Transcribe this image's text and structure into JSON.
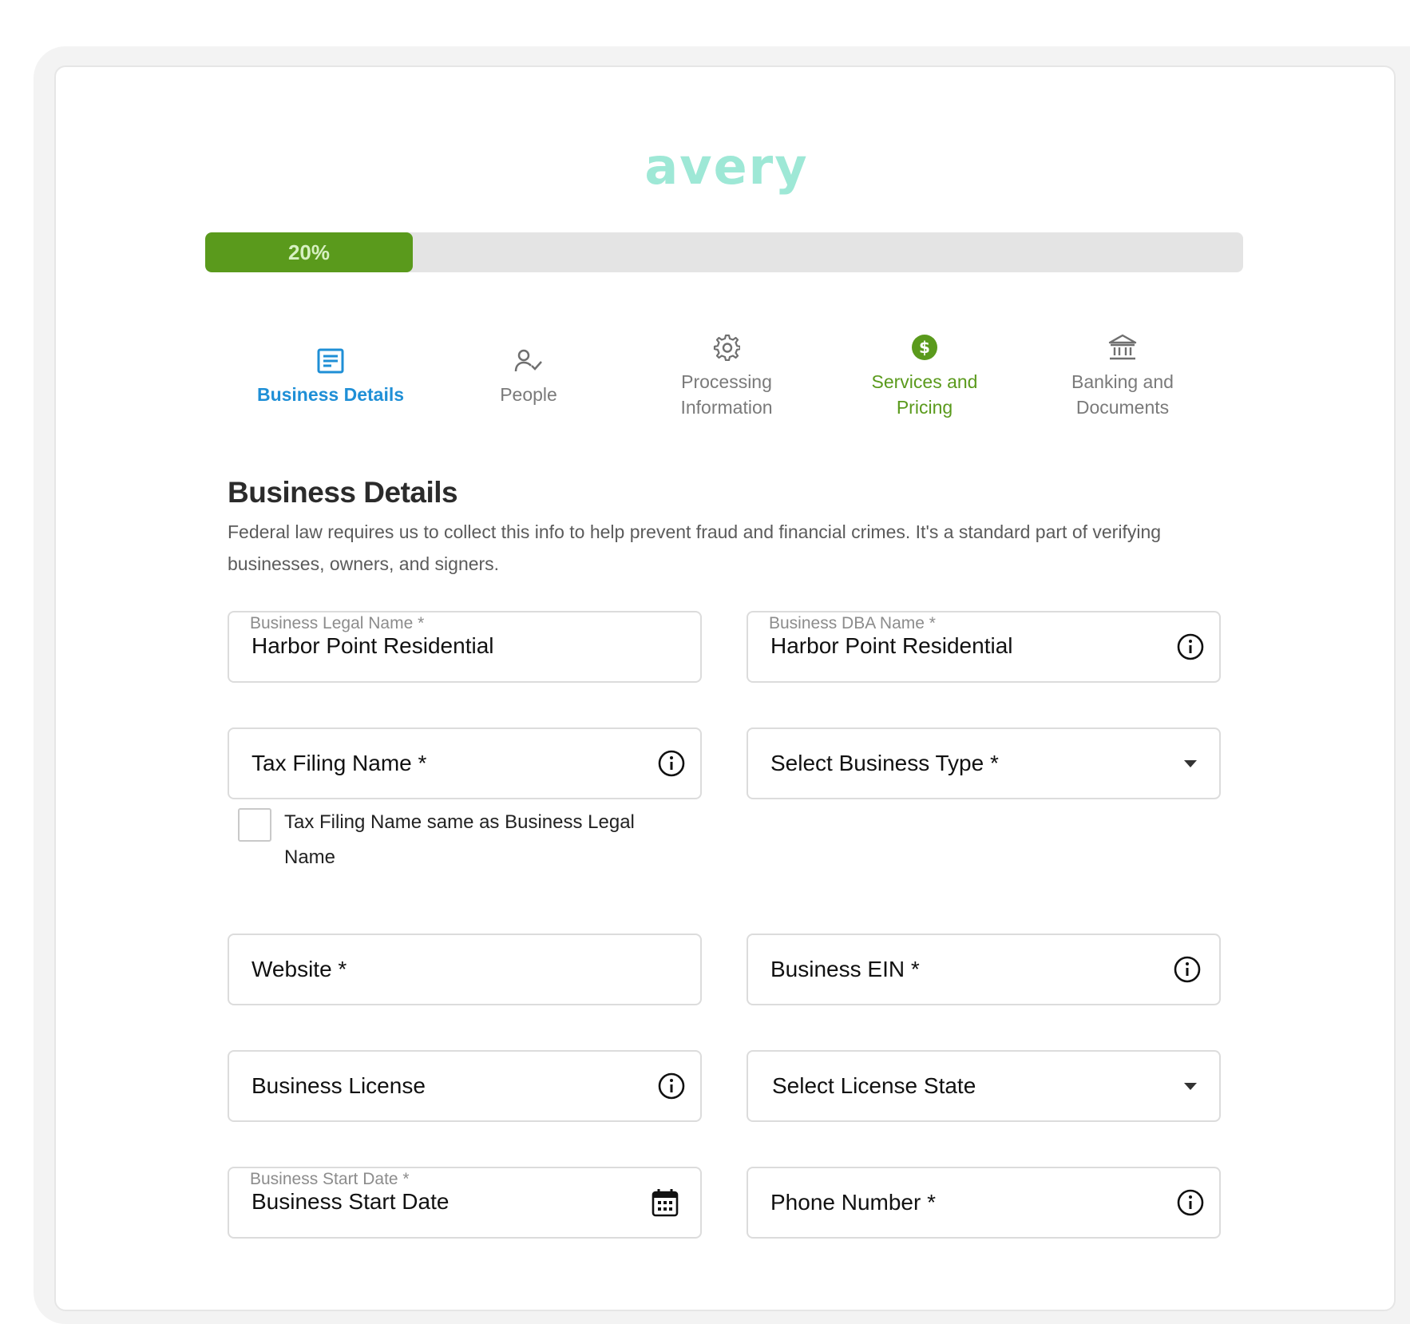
{
  "brand": {
    "logo_text": "avery",
    "logo_color": "#9ee8d6"
  },
  "progress": {
    "percent": 20,
    "label": "20%",
    "fill_color": "#5a9a1c"
  },
  "steps": [
    {
      "label": "Business Details",
      "icon": "document-icon",
      "state": "active"
    },
    {
      "label": "People",
      "icon": "person-check-icon",
      "state": "default"
    },
    {
      "label": "Processing\nInformation",
      "icon": "gear-icon",
      "state": "default"
    },
    {
      "label": "Services and\nPricing",
      "icon": "dollar-circle-icon",
      "state": "highlight"
    },
    {
      "label": "Banking and\nDocuments",
      "icon": "bank-icon",
      "state": "default"
    }
  ],
  "section": {
    "title": "Business Details",
    "description": "Federal law requires us to collect this info to help prevent fraud and financial crimes. It's a standard part of verifying businesses, owners, and signers."
  },
  "fields": {
    "legal_name": {
      "label": "Business Legal Name *",
      "value": "Harbor Point Residential"
    },
    "dba_name": {
      "label": "Business DBA Name *",
      "value": "Harbor Point Residential"
    },
    "tax_filing_name": {
      "placeholder": "Tax Filing Name *"
    },
    "business_type": {
      "placeholder": "Select Business Type *"
    },
    "website": {
      "placeholder": "Website *"
    },
    "ein": {
      "placeholder": "Business EIN *"
    },
    "license": {
      "placeholder": "Business License"
    },
    "license_state": {
      "placeholder": "Select License State"
    },
    "start_date": {
      "label": "Business Start Date *",
      "value": "Business Start Date"
    },
    "phone": {
      "placeholder": "Phone Number *"
    }
  },
  "checkbox": {
    "label": "Tax Filing Name same as Business Legal Name",
    "checked": false
  },
  "colors": {
    "active_step": "#1f8fd6",
    "highlight_step": "#5a9a1c",
    "muted": "#7a7a7a"
  }
}
